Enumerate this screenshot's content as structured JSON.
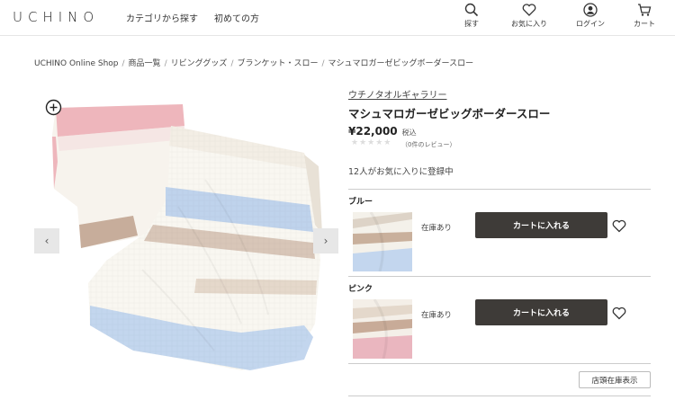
{
  "header": {
    "logo": "UCHINO",
    "nav": [
      "カテゴリから探す",
      "初めての方"
    ],
    "icons": [
      {
        "name": "search-icon",
        "label": "探す"
      },
      {
        "name": "heart-icon",
        "label": "お気に入り"
      },
      {
        "name": "user-icon",
        "label": "ログイン"
      },
      {
        "name": "cart-icon",
        "label": "カート"
      }
    ]
  },
  "breadcrumb": [
    "UCHINO Online Shop",
    "商品一覧",
    "リビンググッズ",
    "ブランケット・スロー",
    "マシュマロガーゼビッグボーダースロー"
  ],
  "product": {
    "brand": "ウチノタオルギャラリー",
    "name": "マシュマロガーゼビッグボーダースロー",
    "price": "¥22,000",
    "tax": "税込",
    "stars": "★★★★★",
    "reviews": "（0件のレビュー）",
    "favorites": "12人がお気に入りに登録中"
  },
  "variants": [
    {
      "label": "ブルー",
      "stock": "在庫あり",
      "cart_label": "カートに入れる"
    },
    {
      "label": "ピンク",
      "stock": "在庫あり",
      "cart_label": "カートに入れる"
    }
  ],
  "store_button": "店頭在庫表示",
  "colors": {
    "cart_button": "#3e3b38",
    "pink_border": "#e9b7bd",
    "blue_stripe": "#b8cde8",
    "beige_stripe": "#c9ad9a"
  }
}
